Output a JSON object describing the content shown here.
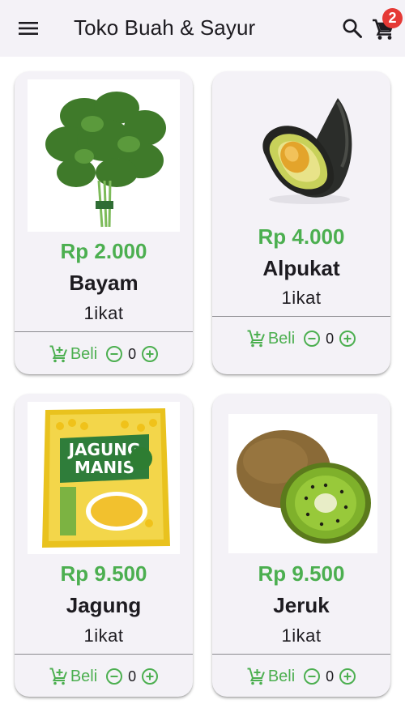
{
  "app_bar": {
    "title": "Toko Buah & Sayur",
    "menu_icon": "menu-icon",
    "search_icon": "search-icon",
    "cart_icon": "shopping-cart-icon",
    "cart_badge": "2",
    "background": "#f4f2f7"
  },
  "colors": {
    "accent": "#4caf50",
    "badge": "#e53935",
    "card_background": "#f4f2f7"
  },
  "products": [
    {
      "name": "Bayam",
      "price": "Rp 2.000",
      "unit": "1ikat",
      "buy_label": "Beli",
      "qty": "0",
      "image": "spinach-image"
    },
    {
      "name": "Alpukat",
      "price": "Rp 4.000",
      "unit": "1ikat",
      "buy_label": "Beli",
      "qty": "0",
      "image": "avocado-image"
    },
    {
      "name": "Jagung",
      "price": "Rp 9.500",
      "unit": "1ikat",
      "buy_label": "Beli",
      "qty": "0",
      "image": "corn-package-image",
      "image_text_1": "JAGUNG",
      "image_text_2": "MANIS"
    },
    {
      "name": "Jeruk",
      "price": "Rp 9.500",
      "unit": "1ikat",
      "buy_label": "Beli",
      "qty": "0",
      "image": "kiwi-image"
    }
  ]
}
